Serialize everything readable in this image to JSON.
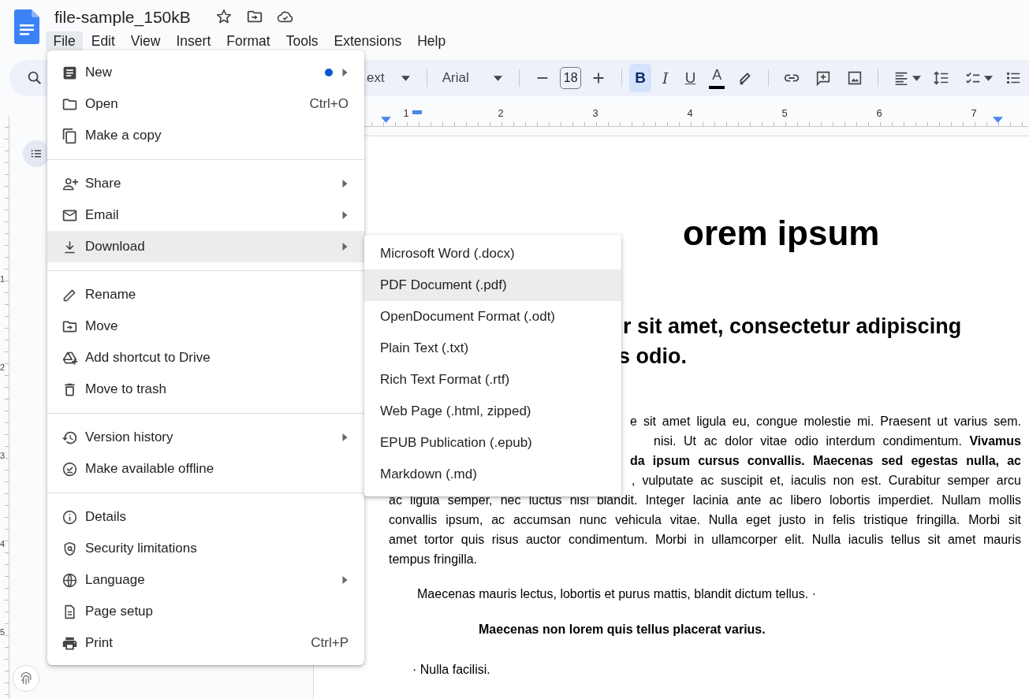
{
  "document": {
    "title": "file-sample_150kB"
  },
  "menu_bar": [
    {
      "label": "File",
      "selected": true
    },
    {
      "label": "Edit",
      "selected": false
    },
    {
      "label": "View",
      "selected": false
    },
    {
      "label": "Insert",
      "selected": false
    },
    {
      "label": "Format",
      "selected": false
    },
    {
      "label": "Tools",
      "selected": false
    },
    {
      "label": "Extensions",
      "selected": false
    },
    {
      "label": "Help",
      "selected": false
    }
  ],
  "toolbar": {
    "style": "ext",
    "font": "Arial",
    "font_size": "18",
    "format_buttons": [
      {
        "label": "B",
        "selected": true
      },
      {
        "label": "I",
        "selected": false
      },
      {
        "label": "U",
        "selected": false
      }
    ],
    "text_color": "A"
  },
  "ruler": {
    "marks": [
      "1",
      "2",
      "3",
      "4",
      "5",
      "6",
      "7"
    ]
  },
  "side_ruler": {
    "marks": [
      "1",
      "2",
      "3",
      "4",
      "5"
    ]
  },
  "file_menu": {
    "groups": [
      {
        "items": [
          {
            "label": "New",
            "dot": true,
            "submenu": true,
            "selected": false
          },
          {
            "label": "Open",
            "shortcut": "Ctrl+O",
            "submenu": false,
            "selected": false
          },
          {
            "label": "Make a copy",
            "submenu": false,
            "selected": false
          }
        ]
      },
      {
        "items": [
          {
            "label": "Share",
            "submenu": true,
            "selected": false
          },
          {
            "label": "Email",
            "submenu": true,
            "selected": false
          },
          {
            "label": "Download",
            "submenu": true,
            "selected": true
          }
        ]
      },
      {
        "items": [
          {
            "label": "Rename",
            "submenu": false,
            "selected": false
          },
          {
            "label": "Move",
            "submenu": false,
            "selected": false
          },
          {
            "label": "Add shortcut to Drive",
            "submenu": false,
            "selected": false
          },
          {
            "label": "Move to trash",
            "submenu": false,
            "selected": false
          }
        ]
      },
      {
        "items": [
          {
            "label": "Version history",
            "submenu": true,
            "selected": false
          },
          {
            "label": "Make available offline",
            "submenu": false,
            "selected": false
          }
        ]
      },
      {
        "items": [
          {
            "label": "Details",
            "submenu": false,
            "selected": false
          },
          {
            "label": "Security limitations",
            "submenu": false,
            "selected": false
          },
          {
            "label": "Language",
            "submenu": true,
            "selected": false
          },
          {
            "label": "Page setup",
            "submenu": false,
            "selected": false
          },
          {
            "label": "Print",
            "shortcut": "Ctrl+P",
            "submenu": false,
            "selected": false
          }
        ]
      }
    ]
  },
  "download_menu": {
    "items": [
      {
        "label": "Microsoft Word (.docx)",
        "selected": false
      },
      {
        "label": "PDF Document (.pdf)",
        "selected": true
      },
      {
        "label": "OpenDocument Format (.odt)",
        "selected": false
      },
      {
        "label": "Plain Text (.txt)",
        "selected": false
      },
      {
        "label": "Rich Text Format (.rtf)",
        "selected": false
      },
      {
        "label": "Web Page (.html, zipped)",
        "selected": false
      },
      {
        "label": "EPUB Publication (.epub)",
        "selected": false
      },
      {
        "label": "Markdown (.md)",
        "selected": false
      }
    ]
  },
  "page": {
    "title": "orem ipsum",
    "subtitle_lines": [
      "r sit amet, consectetur adipiscing",
      "s odio."
    ],
    "paragraph_lines": [
      {
        "text": "e sit amet ligula eu, congue molestie mi. Praesent ut varius sem.",
        "bold": false
      },
      {
        "text": "nisi. Ut ac dolor vitae odio interdum condimentum. **Vivamus**",
        "bold": false
      },
      {
        "text": "da ipsum cursus convallis. Maecenas sed egestas nulla, ac",
        "bold": true
      },
      {
        "text": ", vulputate ac suscipit et, iaculis non est. Curabitur semper arcu",
        "bold": false
      },
      {
        "text": "ac ligula semper, nec luctus nisi blandit. Integer lacinia ante ac libero lobortis imperdiet. Nullam mollis",
        "bold": false
      },
      {
        "text": "convallis ipsum, ac accumsan nunc vehicula vitae. Nulla eget justo in felis tristique fringilla. Morbi sit",
        "bold": false
      },
      {
        "text": "amet tortor quis risus auctor condimentum. Morbi in ullamcorper elit. Nulla iaculis tellus sit amet mauris",
        "bold": false
      },
      {
        "text": "tempus fringilla.",
        "bold": false
      }
    ],
    "indented": "Maecenas mauris lectus, lobortis et purus mattis, blandit dictum tellus. ·",
    "centered": "Maecenas non lorem quis tellus placerat varius.",
    "bullet": "· Nulla facilisi."
  }
}
